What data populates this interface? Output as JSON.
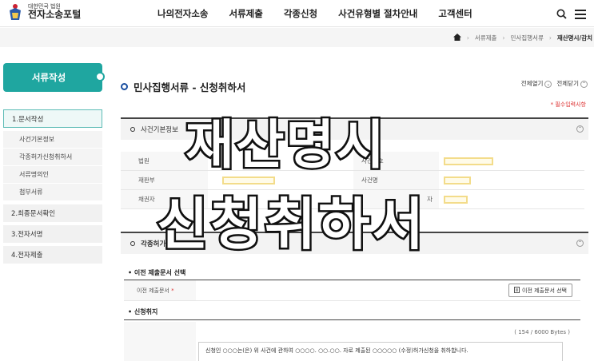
{
  "header": {
    "logo_small": "대한민국 법원",
    "logo_main": "전자소송포털",
    "nav": [
      "나의전자소송",
      "서류제출",
      "각종신청",
      "사건유형별 절차안내",
      "고객센터"
    ],
    "search_icon": "search-icon",
    "menu_icon": "hamburger-icon"
  },
  "breadcrumb": {
    "items": [
      "서류제출",
      "민사집행서류"
    ],
    "current": "재산명시/감치"
  },
  "sidebar": {
    "title": "서류작성",
    "items": [
      {
        "label": "1.문서작성",
        "active": true,
        "sub": [
          "사건기본정보",
          "각종허가신청취하서",
          "서류명의인",
          "첨부서류"
        ]
      },
      {
        "label": "2.최종문서확인"
      },
      {
        "label": "3.전자서명"
      },
      {
        "label": "4.전자제출"
      }
    ]
  },
  "main": {
    "title": "민사집행서류 - 신청취하서",
    "expand_all": "전체열기",
    "collapse_all": "전체닫기",
    "required_note": "* 필수입력사항",
    "section1": {
      "title": "사건기본정보",
      "rows": [
        {
          "l1": "법원",
          "l2": "사건번호"
        },
        {
          "l1": "재판부",
          "l2": "사건명"
        },
        {
          "l1": "채권자",
          "l2": "자"
        }
      ]
    },
    "section2": {
      "title": "각종허가신",
      "prev_doc_heading": "이전 제출문서 선택",
      "prev_doc_label": "이전 제출문서",
      "prev_doc_required": "*",
      "prev_doc_button": "이전 제출문서 선택",
      "reason_heading": "신청취지",
      "bytes": "( 154 / 6000 Bytes )",
      "reason_text": "신청인 ○○○는(은) 위 사건에 관하여 ○○○○. ○○.○○. 자로 제출된 ○○○○○ (수정)허가신청을 취하합니다."
    }
  },
  "overlay": {
    "line1": "재산명시",
    "line2": "신청취하서"
  },
  "colors": {
    "accent": "#1fa6a0",
    "required": "#dd3333",
    "redact": "#f3dc8a"
  }
}
